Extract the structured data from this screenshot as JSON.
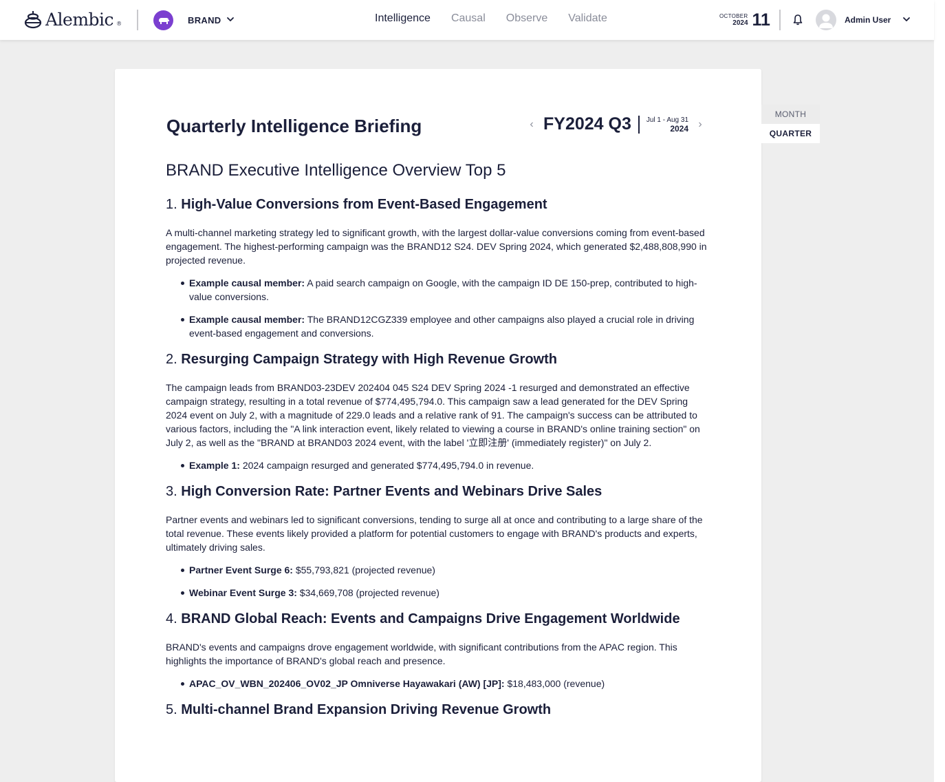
{
  "header": {
    "logo_text": "Alembic",
    "logo_reg": "®",
    "brand_name": "BRAND",
    "nav": [
      "Intelligence",
      "Causal",
      "Observe",
      "Validate"
    ],
    "nav_active": "Intelligence",
    "date_month": "OCTOBER",
    "date_year": "2024",
    "date_day": "11",
    "user_name": "Admin User"
  },
  "briefing": {
    "title": "Quarterly Intelligence Briefing",
    "period_label": "FY2024 Q3",
    "period_range": "Jul 1 - Aug 31",
    "period_year": "2024",
    "prev_arrow": "‹",
    "next_arrow": "›",
    "toggle_month": "MONTH",
    "toggle_quarter": "QUARTER",
    "overview": "BRAND Executive Intelligence Overview Top 5"
  },
  "sections": [
    {
      "num": "1.",
      "title": "High-Value Conversions from Event-Based Engagement",
      "para": "A multi-channel marketing strategy led to significant growth, with the largest dollar-value conversions coming from event-based engagement. The highest-performing campaign was the BRAND12 S24. DEV Spring 2024, which generated $2,488,808,990 in projected revenue.",
      "bullets": [
        {
          "label": "Example causal member:",
          "text": "A paid search campaign on Google, with the campaign ID DE 150-prep, contributed to high-value conversions."
        },
        {
          "label": "Example causal member:",
          "text": "The BRAND12CGZ339 employee and other campaigns also played a crucial role in driving event-based engagement and conversions."
        }
      ]
    },
    {
      "num": "2.",
      "title": "Resurging Campaign Strategy with High Revenue Growth",
      "para": "The campaign leads from BRAND03-23DEV 202404 045 S24 DEV Spring 2024 -1 resurged and demonstrated an effective campaign strategy, resulting in a total revenue of $774,495,794.0. This campaign saw a lead generated for the DEV Spring 2024 event on July 2, with a magnitude of 229.0 leads and a relative rank of 91. The campaign's success can be attributed to various factors, including the \"A link interaction event, likely related to viewing a course in BRAND's online training section\" on July 2, as well as the \"BRAND at BRAND03 2024 event, with the label '立即注册' (immediately register)\" on July 2.",
      "bullets": [
        {
          "label": "Example 1:",
          "text": "2024 campaign resurged and generated $774,495,794.0 in revenue."
        }
      ]
    },
    {
      "num": "3.",
      "title": "High Conversion Rate: Partner Events and Webinars Drive Sales",
      "para": "Partner events and webinars led to significant conversions, tending to surge all at once and contributing to a large share of the total revenue. These events likely provided a platform for potential customers to engage with BRAND's products and experts, ultimately driving sales.",
      "bullets": [
        {
          "label": "Partner Event Surge 6:",
          "text": "$55,793,821 (projected revenue)"
        },
        {
          "label": "Webinar Event Surge 3:",
          "text": "$34,669,708 (projected revenue)"
        }
      ]
    },
    {
      "num": "4.",
      "title": "BRAND Global Reach: Events and Campaigns Drive Engagement Worldwide",
      "para": "BRAND's events and campaigns drove engagement worldwide, with significant contributions from the APAC region. This highlights the importance of BRAND's global reach and presence.",
      "bullets": [
        {
          "label": "APAC_OV_WBN_202406_OV02_JP Omniverse Hayawakari (AW) [JP]:",
          "text": "$18,483,000 (revenue)"
        }
      ]
    },
    {
      "num": "5.",
      "title": "Multi-channel Brand Expansion Driving Revenue Growth",
      "para": "",
      "bullets": []
    }
  ],
  "colors": {
    "accent": "#7b3fd0",
    "text": "#1b1f3a",
    "muted": "#8a8d9a",
    "background": "#eeeeee"
  }
}
